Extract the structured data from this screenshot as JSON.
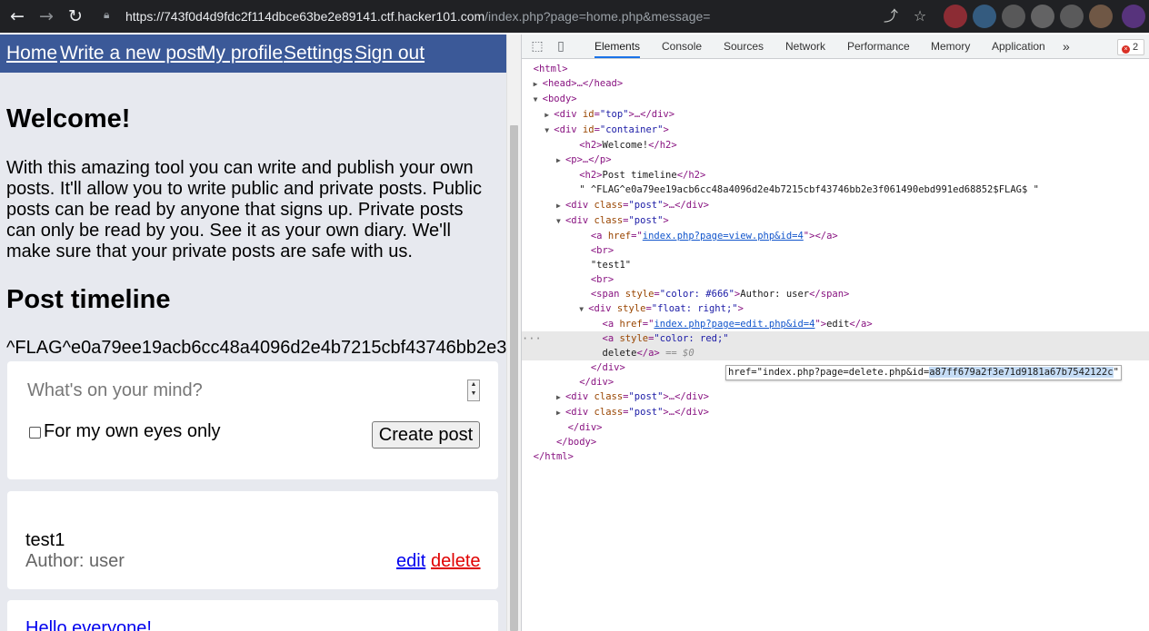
{
  "browser": {
    "url_host": "https://743f0d4d9fdc2f114dbce63be2e89141.ctf.hacker101.com",
    "url_path": "/index.php?page=home.php&message=",
    "back_icon": "arrow-left-icon",
    "forward_icon": "arrow-right-icon",
    "reload_icon": "reload-icon",
    "lock_icon": "lock-icon",
    "share_icon": "share-icon",
    "star_icon": "star-icon"
  },
  "site": {
    "nav": [
      "Home",
      "Write a new post",
      "My profile",
      "Settings",
      "Sign out"
    ],
    "welcome_heading": "Welcome!",
    "intro": "With this amazing tool you can write and publish your own posts. It'll allow you to write public and private posts. Public posts can be read by anyone that signs up. Private posts can only be read by you. See it as your own diary. We'll make sure that your private posts are safe with us.",
    "timeline_heading": "Post timeline",
    "flag_text": "^FLAG^e0a79ee19acb6cc48a4096d2e4b7215cbf43746bb2e3",
    "composer": {
      "placeholder": "What's on your mind?",
      "private_label": "For my own eyes only",
      "submit_label": "Create post"
    },
    "posts": [
      {
        "title": "test1",
        "author": "Author: user",
        "edit": "edit",
        "delete": "delete"
      },
      {
        "link": "Hello everyone!"
      }
    ]
  },
  "devtools": {
    "tabs": [
      "Elements",
      "Console",
      "Sources",
      "Network",
      "Performance",
      "Memory",
      "Application"
    ],
    "active_tab": "Elements",
    "more": "»",
    "error_count": "2",
    "tooltip_prefix": "href=\"index.php?page=delete.php&id=",
    "tooltip_highlight": "a87ff679a2f3e71d9181a67b7542122c",
    "tooltip_suffix": "\"",
    "dom": {
      "l0": "<html>",
      "l1_tag": "<head>…</head>",
      "l2": "<body>",
      "l3_open": "<div ",
      "l3_attr": "id",
      "l3_val": "\"top\"",
      "l3_close": ">…</div>",
      "l4_open": "<div ",
      "l4_attr": "id",
      "l4_val": "\"container\"",
      "l4_close": ">",
      "l5_a": "<h2>",
      "l5_b": "Welcome!",
      "l5_c": "</h2>",
      "l6": "<p>…</p>",
      "l7_a": "<h2>",
      "l7_b": "Post timeline",
      "l7_c": "</h2>",
      "l8": "\" ^FLAG^e0a79ee19acb6cc48a4096d2e4b7215cbf43746bb2e3f061490ebd991ed68852$FLAG$ \"",
      "l9_open": "<div ",
      "l9_attr": "class",
      "l9_val": "\"post\"",
      "l9_close": ">…</div>",
      "l10_open": "<div ",
      "l10_attr": "class",
      "l10_val": "\"post\"",
      "l10_close": ">",
      "l11_open": "<a ",
      "l11_attr": "href",
      "l11_eq": "=\"",
      "l11_link": "index.php?page=view.php&id=4",
      "l11_close": "\"></a>",
      "l12": "<br>",
      "l13": "\"test1\"",
      "l14": "<br>",
      "l15_open": "<span ",
      "l15_attr": "style",
      "l15_val": "\"color: #666\"",
      "l15_mid": ">",
      "l15_text": "Author: user",
      "l15_close": "</span>",
      "l16_open": "<div ",
      "l16_attr": "style",
      "l16_val": "\"float: right;\"",
      "l16_close": ">",
      "l17_open": "<a ",
      "l17_attr": "href",
      "l17_eq": "=\"",
      "l17_link": "index.php?page=edit.php&id=4",
      "l17_mid": "\">",
      "l17_text": "edit",
      "l17_close": "</a>",
      "l18_open": "<a ",
      "l18_attr": "style",
      "l18_val": "\"color: red;\"",
      "l19_text": "delete",
      "l19_close": "</a>",
      "l19_eq": " == $0",
      "l20": "</div>",
      "l21": "</div>",
      "l22_open": "<div ",
      "l22_attr": "class",
      "l22_val": "\"post\"",
      "l22_close": ">…</div>",
      "l23_open": "<div ",
      "l23_attr": "class",
      "l23_val": "\"post\"",
      "l23_close": ">…</div>",
      "l24": "</div>",
      "l25": "</body>",
      "l26": "</html>",
      "ellipsis": "···"
    }
  },
  "colors": {
    "nav_bg": "#3b5998",
    "page_bg": "#e7e9ef",
    "delete_link": "#e00000",
    "edit_link": "#0000ee",
    "devtools_active_tab": "#1a73e8",
    "tag_color": "#881280",
    "attr_color": "#994500",
    "value_color": "#1a1aa6"
  }
}
